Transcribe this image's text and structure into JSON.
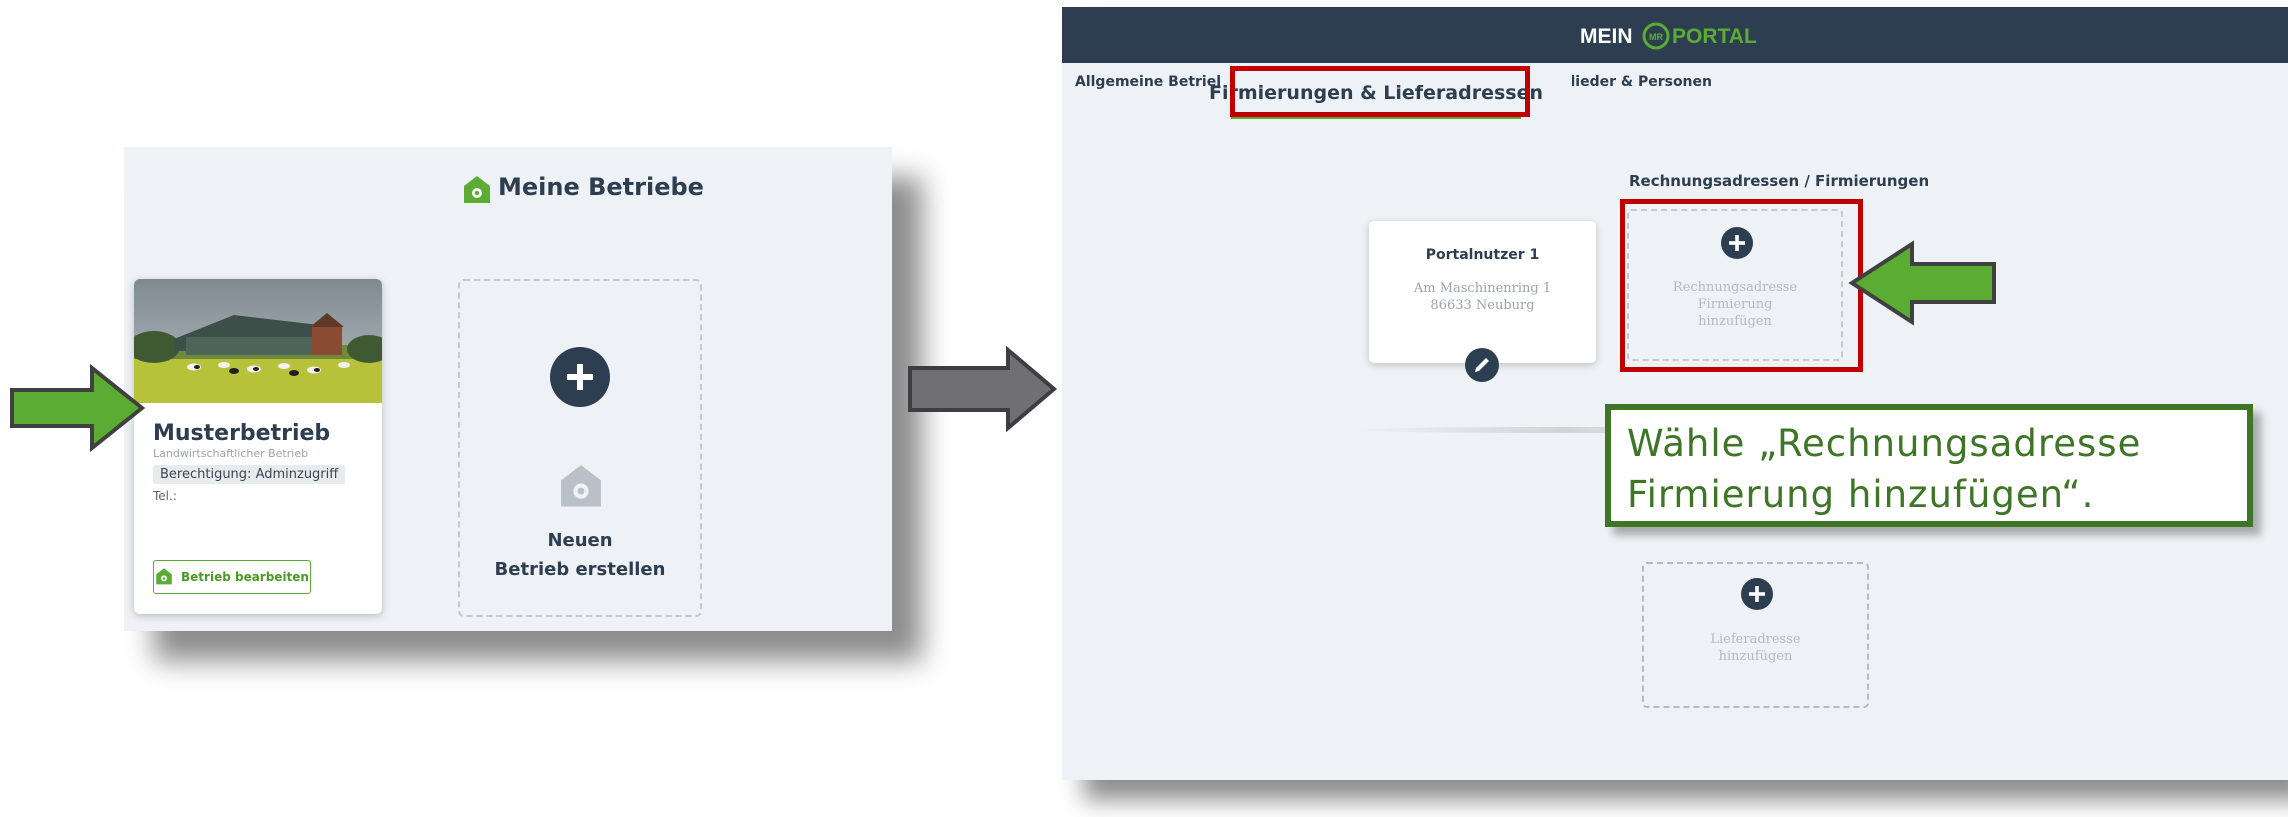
{
  "left_panel": {
    "title": "Meine Betriebe",
    "farm_card": {
      "name": "Musterbetrieb",
      "type": "Landwirtschaftlicher Betrieb",
      "permission": "Berechtigung: Adminzugriff",
      "tel": "Tel.:",
      "edit_button": "Betrieb bearbeiten"
    },
    "new_farm": {
      "line1": "Neuen",
      "line2": "Betrieb erstellen"
    }
  },
  "right_panel": {
    "logo": {
      "left": "MEIN",
      "center": "MR",
      "right": "PORTAL"
    },
    "tabs": {
      "general": "Allgemeine Betriebsdaten",
      "active": "Firmierungen & Lieferadressen",
      "persons": "Mitglieder & Personen"
    },
    "section_heading": "Rechnungsadressen / Firmierungen",
    "user_card": {
      "name": "Portalnutzer 1",
      "street": "Am Maschinenring 1",
      "city": "86633 Neuburg"
    },
    "add_invoice": {
      "line1": "Rechnungsadresse",
      "line2": "Firmierung",
      "line3": "hinzufügen"
    },
    "add_delivery": {
      "line1": "Lieferadresse",
      "line2": "hinzufügen"
    }
  },
  "callout": {
    "text": "Wähle „Rechnungsadresse Firmierung hinzufügen“."
  },
  "colors": {
    "navy": "#2c3e50",
    "green": "#5aad32",
    "highlight_red": "#c00000",
    "callout_green": "#3f7527",
    "arrow_gray": "#6b6b6b"
  }
}
